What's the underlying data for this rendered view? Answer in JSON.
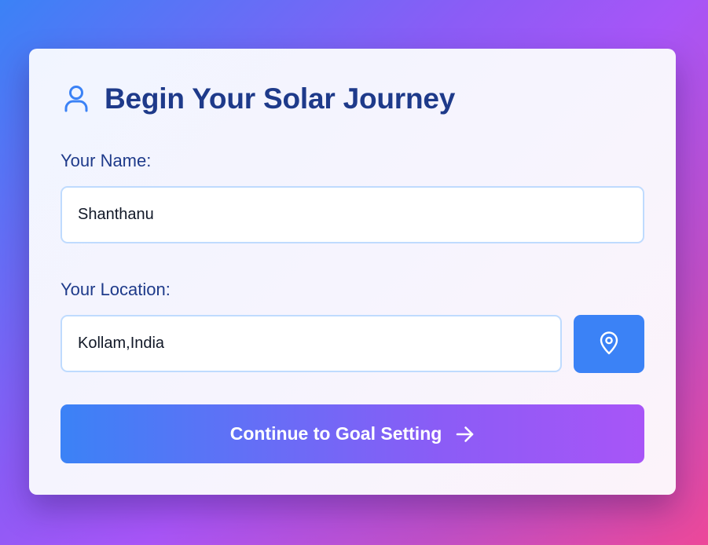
{
  "form": {
    "title": "Begin Your Solar Journey",
    "title_icon": "user-icon",
    "name_label": "Your Name:",
    "name_value": "Shanthanu",
    "location_label": "Your Location:",
    "location_value": "Kollam,India",
    "locate_icon": "map-pin-icon",
    "continue_label": "Continue to Goal Setting",
    "continue_icon": "arrow-right-icon"
  },
  "colors": {
    "accent_blue": "#3b82f6",
    "accent_purple": "#a855f7",
    "accent_pink": "#ec4899",
    "heading": "#1e3a8a",
    "input_border": "#bfdbfe"
  }
}
